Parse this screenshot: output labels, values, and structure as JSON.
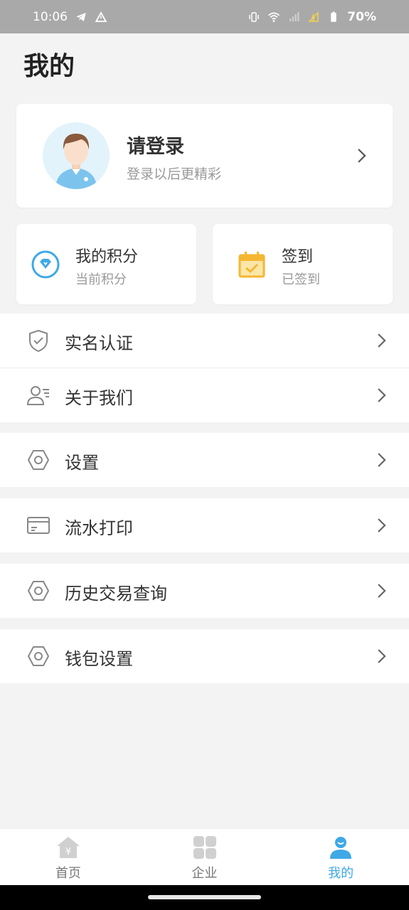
{
  "status": {
    "time": "10:06",
    "battery": "70%"
  },
  "page_title": "我的",
  "profile": {
    "title": "请登录",
    "subtitle": "登录以后更精彩"
  },
  "quick_cards": {
    "points": {
      "title": "我的积分",
      "subtitle": "当前积分"
    },
    "signin": {
      "title": "签到",
      "subtitle": "已签到"
    }
  },
  "menu": [
    {
      "label": "实名认证",
      "icon": "shield-check-icon"
    },
    {
      "label": "关于我们",
      "icon": "user-info-icon"
    },
    {
      "label": "设置",
      "icon": "gear-icon"
    },
    {
      "label": "流水打印",
      "icon": "card-icon"
    },
    {
      "label": "历史交易查询",
      "icon": "gear-icon"
    },
    {
      "label": "钱包设置",
      "icon": "gear-icon"
    }
  ],
  "tabs": [
    {
      "label": "首页",
      "icon": "home-yen-icon",
      "active": false
    },
    {
      "label": "企业",
      "icon": "grid-icon",
      "active": false
    },
    {
      "label": "我的",
      "icon": "user-icon",
      "active": true
    }
  ],
  "colors": {
    "accent": "#3ea9e6",
    "signin_icon": "#f5b731",
    "status_bar": "#a9a9a9"
  }
}
